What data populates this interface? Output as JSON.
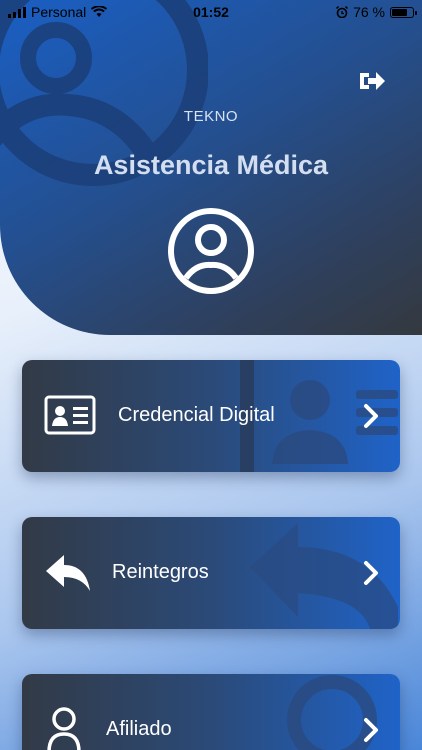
{
  "status_bar": {
    "carrier": "Personal",
    "time": "01:52",
    "battery_percent": "76 %",
    "battery_level": 0.76
  },
  "header": {
    "company": "TEKNO",
    "title": "Asistencia Médica",
    "logout_icon": "logout-icon",
    "avatar_icon": "user-circle-icon"
  },
  "menu": {
    "items": [
      {
        "label": "Credencial Digital",
        "icon": "id-card-icon"
      },
      {
        "label": "Reintegros",
        "icon": "reply-arrow-icon"
      },
      {
        "label": "Afiliado",
        "icon": "user-icon"
      }
    ]
  },
  "colors": {
    "header_start": "#1a5fc4",
    "header_end": "#34393f",
    "card_start": "#323a46",
    "card_end": "#1f63c8"
  }
}
